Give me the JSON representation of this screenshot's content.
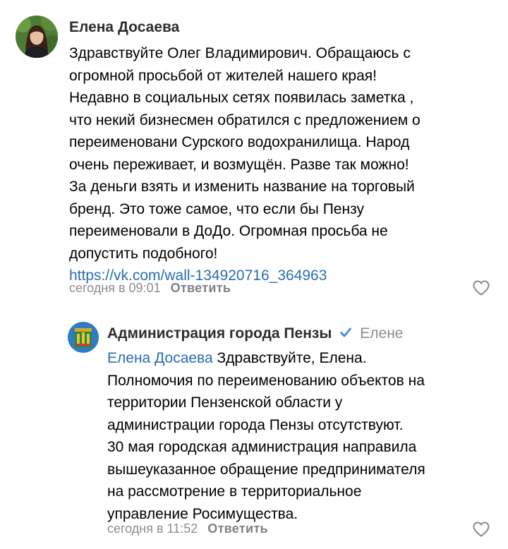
{
  "comment": {
    "author": "Елена Досаева",
    "lines": [
      "Здравствуйте Олег Владимирович. Обращаюсь с",
      "огромной просьбой от жителей нашего края!",
      "Недавно в социальных сетях появилась заметка ,",
      "что некий бизнесмен обратился с предложением о",
      "переименовани Сурского водохранилища. Народ",
      "очень переживает, и возмущён. Разве так можно!",
      "За деньги взять и изменить название на торговый",
      "бренд. Это тоже самое, что если бы Пензу",
      "переименовали в ДоДо. Огромная просьба не",
      "допустить подобного!"
    ],
    "link": "https://vk.com/wall-134920716_364963",
    "time": "сегодня в 09:01",
    "reply_label": "Ответить",
    "like_icon": "heart-outline-icon"
  },
  "reply": {
    "author": "Администрация города Пензы",
    "verified_icon": "verified-check-icon",
    "to": "Елене",
    "mention": "Елена Досаева",
    "first_line_rest": " Здравствуйте, Елена.",
    "lines": [
      "Полномочия по переименованию объектов на",
      "территории Пензенской области у",
      "администрации города Пензы отсутствуют.",
      "30 мая городская администрация направила",
      "вышеуказанное обращение предпринимателя",
      "на рассмотрение в территориальное",
      "управление Росимущества."
    ],
    "time": "сегодня в 11:52",
    "reply_label": "Ответить",
    "like_icon": "heart-outline-icon"
  },
  "colors": {
    "link": "#2a6db3",
    "meta": "#8a8d92",
    "verified": "#3f8ae0"
  }
}
